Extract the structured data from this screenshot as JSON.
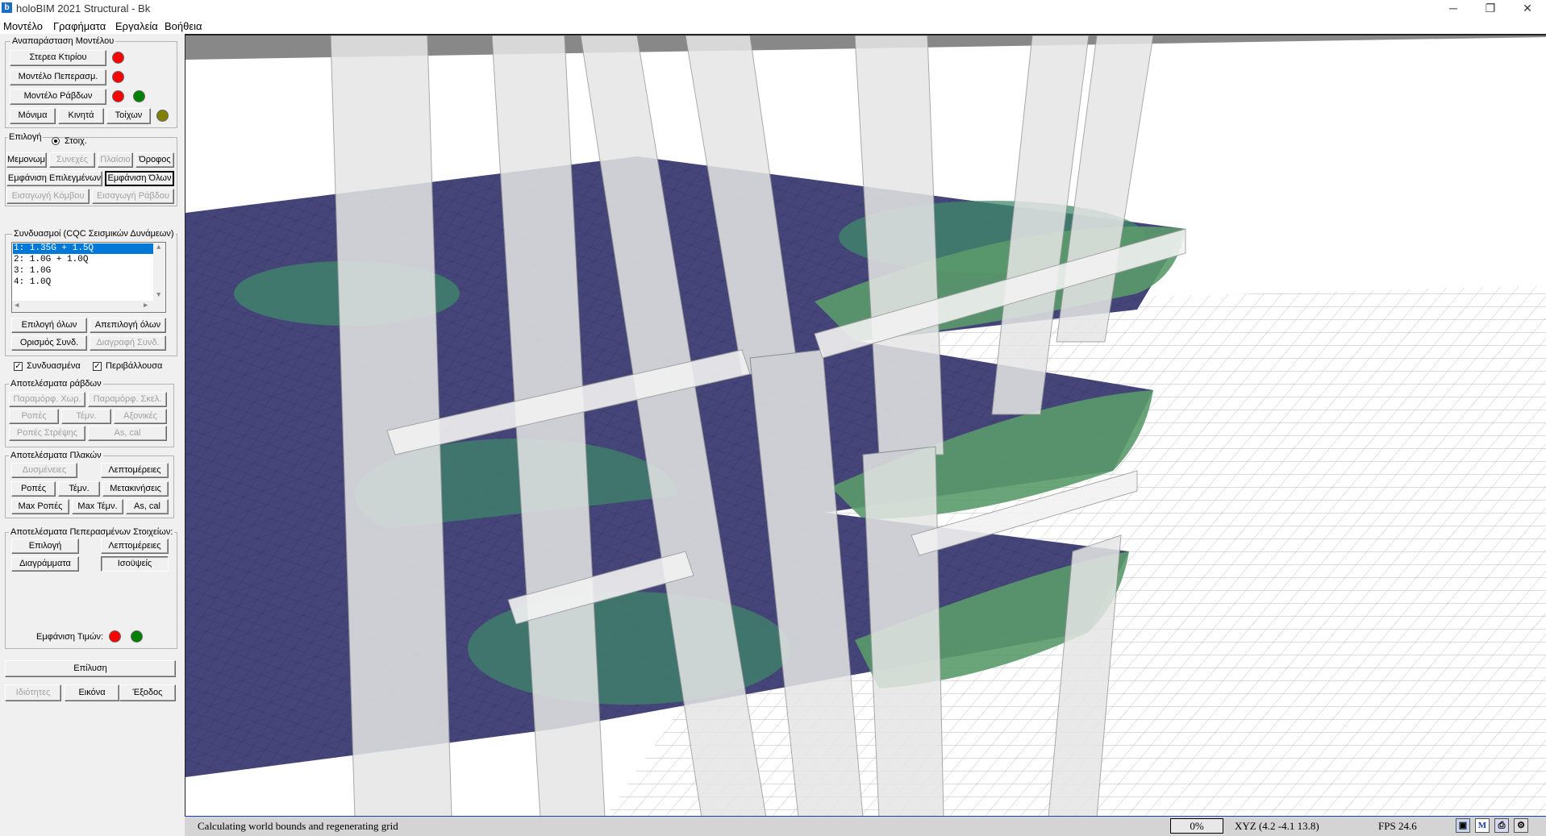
{
  "window": {
    "title": "holoBIM 2021 Structural - Bk",
    "app_icon": "b",
    "minimize": "─",
    "restore": "❐",
    "close": "✕"
  },
  "menu": [
    "Μοντέλο",
    "Γραφήματα",
    "Εργαλεία",
    "Βοήθεια"
  ],
  "representation": {
    "title": "Αναπαράσταση Μοντέλου",
    "solid_btn": "Στερεα Κτιρίου",
    "fe_btn": "Μοντέλο Πεπερασμ.",
    "bars_btn": "Μοντέλο Ράβδων",
    "permanent_btn": "Μόνιμα",
    "moving_btn": "Κινητά",
    "walls_btn": "Τοίχων"
  },
  "selection": {
    "title": "Επιλογή",
    "radio_label": "Στοιχ.",
    "isolated_btn": "Μεμονωμ.",
    "continuous_btn": "Συνεχές",
    "frame_btn": "Πλαίσιο",
    "floor_btn": "Όροφος",
    "show_selected_btn": "Εμφάνιση Επιλεγμένων",
    "show_all_btn": "Εμφάνιση Όλων",
    "insert_node_btn": "Εισαγωγή Κόμβου",
    "insert_bar_btn": "Εισαγωγή Ράβδου"
  },
  "combinations": {
    "title": "Συνδυασμοί (CQC Σεισμικών Δυνάμεων)",
    "items": [
      "1: 1.35G + 1.5Q",
      "2: 1.0G + 1.0Q",
      "3: 1.0G",
      "4: 1.0Q"
    ],
    "select_all_btn": "Επιλογή όλων",
    "deselect_all_btn": "Απεπιλογή όλων",
    "define_btn": "Ορισμός Συνδ.",
    "delete_btn": "Διαγραφή Συνδ.",
    "combined_label": "Συνδυασμένα",
    "envelope_label": "Περιβάλλουσα"
  },
  "bar_results": {
    "title": "Αποτελέσματα ράβδων",
    "spatial_deform_btn": "Παραμόρφ. Χωρ.",
    "skeleton_deform_btn": "Παραμόρφ. Σκελ.",
    "moments_btn": "Ροπές",
    "shear_btn": "Τέμν.",
    "axial_btn": "Αξονικές",
    "torsion_btn": "Ροπές Στρέψης",
    "as_cal_btn": "As, cal"
  },
  "slab_results": {
    "title": "Αποτελέσματα Πλακών",
    "forces_btn": "Δυσμένειες",
    "details_btn": "Λεπτομέρειες",
    "moments_btn": "Ροπές",
    "shear_btn": "Τέμν.",
    "displacements_btn": "Μετακινήσεις",
    "max_moments_btn": "Max Ροπές",
    "max_shear_btn": "Max Τέμν.",
    "as_cal_btn": "As, cal"
  },
  "fe_results": {
    "title": "Αποτελέσματα Πεπερασμένων Στοιχείων:",
    "select_btn": "Επιλογή",
    "details_btn": "Λεπτομέρειες",
    "diagrams_btn": "Διαγράμματα",
    "contours_btn": "Ισοϋψείς",
    "show_values_label": "Εμφάνιση Τιμών:"
  },
  "bottom": {
    "solve_btn": "Επίλυση",
    "properties_btn": "Ιδιότητες",
    "image_btn": "Εικόνα",
    "exit_btn": "Έξοδος"
  },
  "colors": {
    "red": "#ff0000",
    "green": "#008000",
    "olive": "#808000",
    "slab_blue": "#45457a",
    "contour_green": "#3f8a6a",
    "highlight_blue": "#0078d7"
  },
  "status": {
    "message": "Calculating world bounds and regenerating grid",
    "progress": "0%",
    "xyz": "XYZ (4.2 -4.1 13.8)",
    "fps": "FPS 24.6",
    "icons": [
      "monitor-icon",
      "m-mode-icon",
      "print-icon",
      "settings-icon"
    ]
  }
}
